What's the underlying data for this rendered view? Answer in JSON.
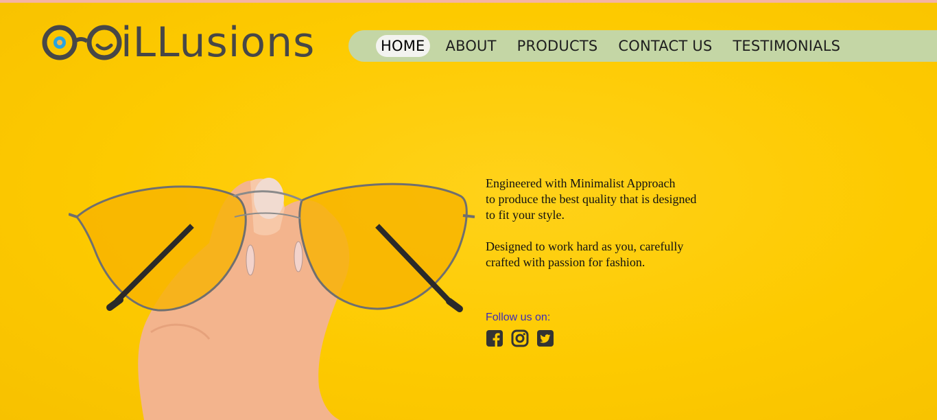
{
  "brand": {
    "name": "iLLusions"
  },
  "nav": {
    "items": [
      {
        "label": "HOME"
      },
      {
        "label": "ABOUT"
      },
      {
        "label": "PRODUCTS"
      },
      {
        "label": "CONTACT US"
      },
      {
        "label": "TESTIMONIALS"
      }
    ]
  },
  "hero": {
    "paragraph_1": {
      "line_1": "Engineered with Minimalist Approach",
      "line_2": "to produce the best quality that is designed",
      "line_3": "to fit your style."
    },
    "paragraph_2": {
      "line_1": "Designed to work hard as you, carefully",
      "line_2": "crafted with passion for fashion."
    },
    "follow_label": "Follow us on:",
    "socials": [
      "facebook-icon",
      "instagram-icon",
      "twitter-icon"
    ]
  },
  "colors": {
    "background": "#fdc900",
    "nav_bar": "#c4d6a5",
    "logo": "#474747",
    "follow_text": "#3c2bb8"
  }
}
